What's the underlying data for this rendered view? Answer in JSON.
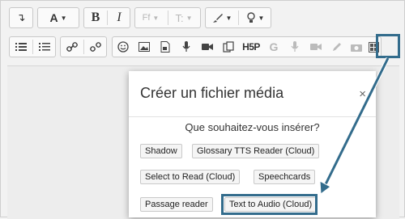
{
  "toolbar": {
    "row1": [
      {
        "name": "undo-redo-button",
        "glyph": "↴"
      },
      {
        "name": "paragraph-style-button",
        "glyph": "A▾"
      },
      {
        "name": "bold-button",
        "glyph": "B"
      },
      {
        "name": "italic-button",
        "glyph": "I"
      },
      {
        "name": "font-family-button",
        "glyph": "Ff▾"
      },
      {
        "name": "font-size-button",
        "glyph": "T↕▾"
      },
      {
        "name": "paint-brush-button",
        "glyph": "🖌▾"
      },
      {
        "name": "lightbulb-button",
        "glyph": "💡▾"
      }
    ],
    "row2_labels": {
      "h5p": "H5P",
      "g": "G"
    }
  },
  "modal": {
    "title": "Créer un fichier média",
    "close": "×",
    "question": "Que souhaitez-vous insérer?",
    "options": {
      "shadow": "Shadow",
      "glossary_tts": "Glossary TTS Reader (Cloud)",
      "select_to_read": "Select to Read (Cloud)",
      "speechcards": "Speechcards",
      "passage_reader": "Passage reader",
      "text_to_audio": "Text to Audio (Cloud)"
    }
  },
  "colors": {
    "highlight": "#336c8c"
  }
}
